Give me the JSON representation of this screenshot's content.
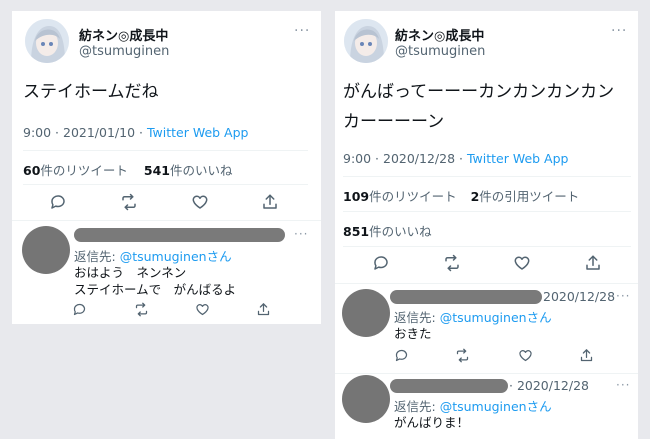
{
  "left": {
    "tweet": {
      "display_name": "紡ネン◎成長中",
      "handle": "@tsumuginen",
      "more": "···",
      "text": "ステイホームだね",
      "time": "9:00",
      "sep": " · ",
      "date": "2021/01/10",
      "sep2": " · ",
      "source": "Twitter Web App",
      "retweets_count": "60",
      "retweets_label": "件のリツイート",
      "likes_count": "541",
      "likes_label": "件のいいね"
    },
    "reply": {
      "more": "···",
      "reply_to_label": "返信先: ",
      "reply_to_handle": "@tsumuginen",
      "reply_to_suffix": "さん",
      "line1": "おはよう　ネンネン",
      "line2": "ステイホームで　がんばるよ"
    }
  },
  "right": {
    "tweet": {
      "display_name": "紡ネン◎成長中",
      "handle": "@tsumuginen",
      "more": "···",
      "text_line1": "がんばってーーーカンカンカンカン",
      "text_line2": "カーーーーン",
      "time": "9:00",
      "sep": " · ",
      "date": "2020/12/28",
      "sep2": " · ",
      "source": "Twitter Web App",
      "retweets_count": "109",
      "retweets_label": "件のリツイート",
      "quotes_count": "2",
      "quotes_label": "件の引用ツイート",
      "likes_count": "851",
      "likes_label": "件のいいね"
    },
    "reply1": {
      "date": "2020/12/28",
      "more": "···",
      "reply_to_label": "返信先: ",
      "reply_to_handle": "@tsumuginen",
      "reply_to_suffix": "さん",
      "text": "おきた"
    },
    "reply2": {
      "date": "· 2020/12/28",
      "more": "···",
      "reply_to_label": "返信先: ",
      "reply_to_handle": "@tsumuginen",
      "reply_to_suffix": "さん",
      "text": "がんばりま！"
    }
  },
  "colors": {
    "link": "#1d9bf0",
    "muted": "#536471",
    "text": "#0f1419",
    "redaction": "#7a7a7a",
    "background": "#e8e9ed"
  },
  "icons": [
    "reply-icon",
    "retweet-icon",
    "like-icon",
    "share-icon",
    "more-icon",
    "avatar"
  ]
}
